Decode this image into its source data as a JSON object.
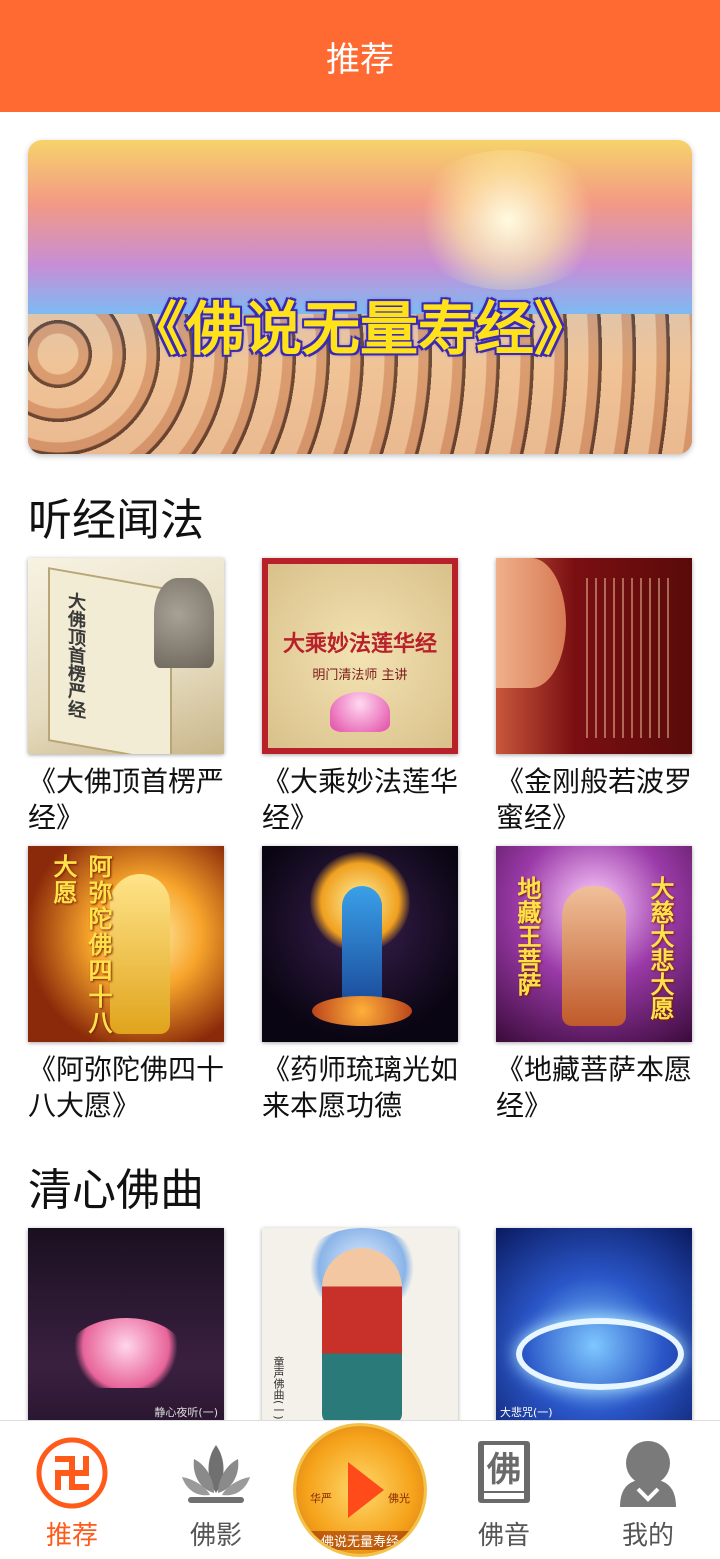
{
  "header": {
    "title": "推荐"
  },
  "banner": {
    "title": "《佛说无量寿经》"
  },
  "sections": [
    {
      "title": "听经闻法",
      "items": [
        {
          "caption": "《大佛顶首楞严经》",
          "thumb_text": "大佛顶首楞严经"
        },
        {
          "caption": "《大乘妙法莲华经》",
          "thumb_text": "大乘妙法莲华经",
          "thumb_sub": "明门清法师 主讲"
        },
        {
          "caption": "《金刚般若波罗蜜经》"
        },
        {
          "caption": "《阿弥陀佛四十八大愿》",
          "thumb_text": "阿弥陀佛四十八大愿"
        },
        {
          "caption": "《药师琉璃光如来本愿功德",
          "thumb_text": ""
        },
        {
          "caption": "《地藏菩萨本愿经》",
          "thumb_text_left": "地藏王菩萨",
          "thumb_text_right": "大慈大悲大愿"
        }
      ]
    },
    {
      "title": "清心佛曲",
      "items": [
        {
          "thumb_text": "静心夜听(一)"
        },
        {
          "thumb_text": "童声佛曲(一)"
        },
        {
          "thumb_text": "大悲咒(一)"
        }
      ]
    }
  ],
  "tabbar": {
    "tabs": [
      {
        "label": "推荐",
        "icon": "swastika-icon",
        "active": true
      },
      {
        "label": "佛影",
        "icon": "lotus-icon",
        "active": false
      },
      {
        "label": "",
        "icon": "play-icon",
        "active": false
      },
      {
        "label": "佛音",
        "icon": "book-icon",
        "active": false
      },
      {
        "label": "我的",
        "icon": "profile-icon",
        "active": false
      }
    ],
    "center_label": "佛说无量寿经",
    "center_side_left": "华严",
    "center_side_right": "佛光"
  },
  "colors": {
    "accent": "#ff6a33",
    "active_tab": "#ff5a1a",
    "inactive_tab": "#555555"
  }
}
